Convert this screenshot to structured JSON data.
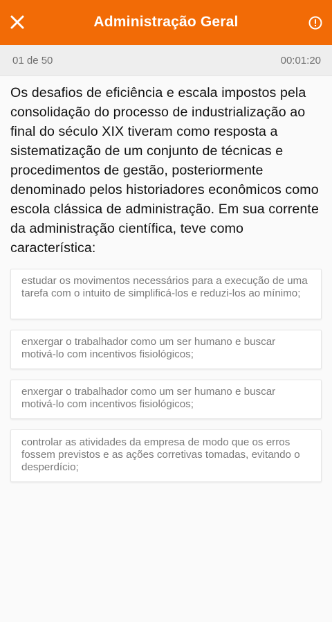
{
  "header": {
    "title": "Administração Geral",
    "close_icon": "close-icon",
    "info_icon": "alert-circle-icon",
    "background_color": "#f26b06"
  },
  "status": {
    "progress": "01 de 50",
    "timer": "00:01:20"
  },
  "question": {
    "text": "Os desafios de eficiência e escala impostos pela consolidação do processo de industrialização ao final do século XIX tiveram como resposta a sistematização de um conjunto de técnicas e procedimentos de gestão, posteriormente denominado pelos historiadores econômicos como escola clássica de administração. Em sua corrente da administração científica, teve como característica:"
  },
  "options": [
    {
      "text": "estudar os movimentos necessários para a execução de uma tarefa com o intuito de simplificá-los e reduzi-los ao mínimo;"
    },
    {
      "text": "enxergar o trabalhador como um ser humano e buscar motivá-lo com incentivos fisiológicos;"
    },
    {
      "text": "enxergar o trabalhador como um ser humano e buscar motivá-lo com incentivos fisiológicos;"
    },
    {
      "text": "controlar as atividades da empresa de modo que os erros fossem previstos e as ações corretivas tomadas, evitando o desperdício;"
    }
  ]
}
